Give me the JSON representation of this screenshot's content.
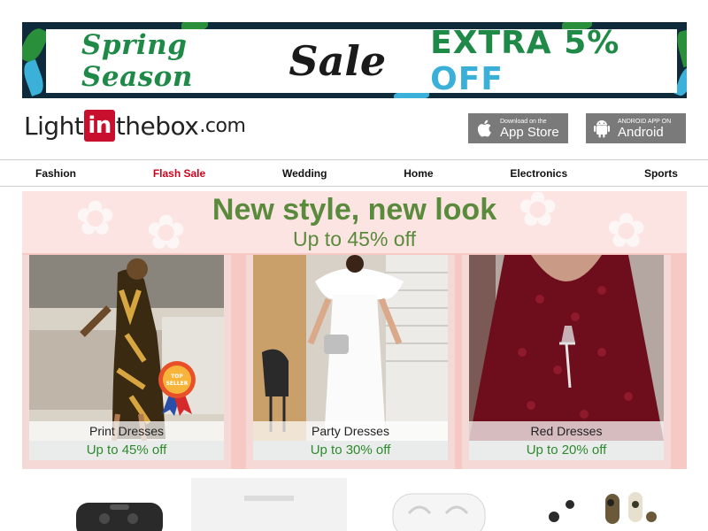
{
  "promo": {
    "spring": "Spring Season",
    "sale": "Sale",
    "extra": "EXTRA 5%",
    "off": "OFF",
    "colors": {
      "green": "#1f8a48",
      "blue": "#3ab0d9",
      "frame": "#0f2a3a"
    }
  },
  "logo": {
    "light": "Light",
    "in": "in",
    "thebox": "thebox",
    "com": ".com",
    "brand_red": "#c8102e"
  },
  "apps": {
    "appstore": {
      "small": "Download on the",
      "big": "App Store",
      "icon": "apple-icon"
    },
    "android": {
      "small": "ANDROID APP ON",
      "big": "Android",
      "icon": "android-icon"
    }
  },
  "nav": {
    "items": [
      {
        "label": "Fashion"
      },
      {
        "label": "Flash Sale",
        "accent": "#d0021b"
      },
      {
        "label": "Wedding"
      },
      {
        "label": "Home"
      },
      {
        "label": "Electronics"
      },
      {
        "label": "Sports"
      }
    ]
  },
  "hero": {
    "title": "New style, new look",
    "subtitle": "Up to 45% off",
    "cards": [
      {
        "name": "Print Dresses",
        "discount": "Up to 45% off",
        "badge": "TOP SELLER"
      },
      {
        "name": "Party Dresses",
        "discount": "Up to 30% off"
      },
      {
        "name": "Red Dresses",
        "discount": "Up to 20% off"
      }
    ]
  },
  "products": [
    {
      "icon": "game-controller-icon"
    },
    {
      "icon": "product-placeholder-icon"
    },
    {
      "icon": "earbuds-icon"
    },
    {
      "icon": "earbuds-camo-icon"
    }
  ]
}
